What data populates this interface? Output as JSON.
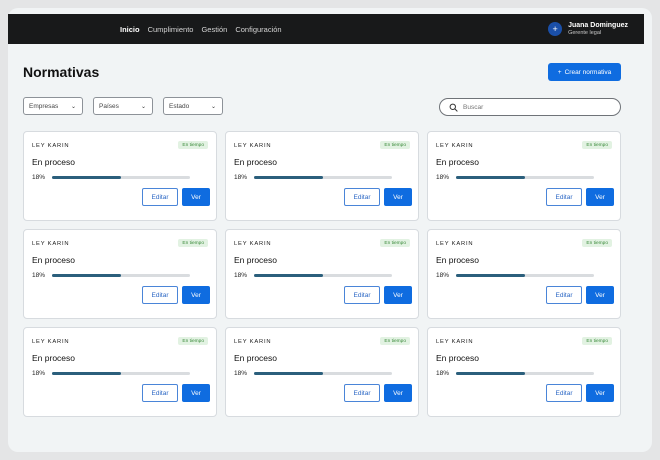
{
  "nav": {
    "items": [
      {
        "label": "Inicio",
        "active": true
      },
      {
        "label": "Cumplimiento",
        "active": false
      },
      {
        "label": "Gestión",
        "active": false
      },
      {
        "label": "Configuración",
        "active": false
      }
    ]
  },
  "user": {
    "name": "Juana Dominguez",
    "role": "Gerente legal",
    "avatar_icon": "plus-icon"
  },
  "page": {
    "title": "Normativas",
    "create_label": "Crear normativa",
    "create_icon": "plus-icon"
  },
  "filters": {
    "empresas": "Empresas",
    "paises": "Países",
    "estado": "Estado"
  },
  "search": {
    "placeholder": "Buscar",
    "icon": "search-icon"
  },
  "colors": {
    "accent": "#0f6ce0",
    "topbar": "#18191a",
    "progress": "#2b5f7c",
    "badge_bg": "#e2f2e2",
    "badge_text": "#3a8a3a"
  },
  "cards": [
    {
      "label": "LEY KARIN",
      "badge": "En tiempo",
      "status": "En proceso",
      "progress_text": "18%",
      "progress": 0.5,
      "edit": "Editar",
      "view": "Ver"
    },
    {
      "label": "LEY KARIN",
      "badge": "En tiempo",
      "status": "En proceso",
      "progress_text": "18%",
      "progress": 0.5,
      "edit": "Editar",
      "view": "Ver"
    },
    {
      "label": "LEY KARIN",
      "badge": "En tiempo",
      "status": "En proceso",
      "progress_text": "18%",
      "progress": 0.5,
      "edit": "Editar",
      "view": "Ver"
    },
    {
      "label": "LEY KARIN",
      "badge": "En tiempo",
      "status": "En proceso",
      "progress_text": "18%",
      "progress": 0.5,
      "edit": "Editar",
      "view": "Ver"
    },
    {
      "label": "LEY KARIN",
      "badge": "En tiempo",
      "status": "En proceso",
      "progress_text": "18%",
      "progress": 0.5,
      "edit": "Editar",
      "view": "Ver"
    },
    {
      "label": "LEY KARIN",
      "badge": "En tiempo",
      "status": "En proceso",
      "progress_text": "18%",
      "progress": 0.5,
      "edit": "Editar",
      "view": "Ver"
    },
    {
      "label": "LEY KARIN",
      "badge": "En tiempo",
      "status": "En proceso",
      "progress_text": "18%",
      "progress": 0.5,
      "edit": "Editar",
      "view": "Ver"
    },
    {
      "label": "LEY KARIN",
      "badge": "En tiempo",
      "status": "En proceso",
      "progress_text": "18%",
      "progress": 0.5,
      "edit": "Editar",
      "view": "Ver"
    },
    {
      "label": "LEY KARIN",
      "badge": "En tiempo",
      "status": "En proceso",
      "progress_text": "18%",
      "progress": 0.5,
      "edit": "Editar",
      "view": "Ver"
    }
  ]
}
